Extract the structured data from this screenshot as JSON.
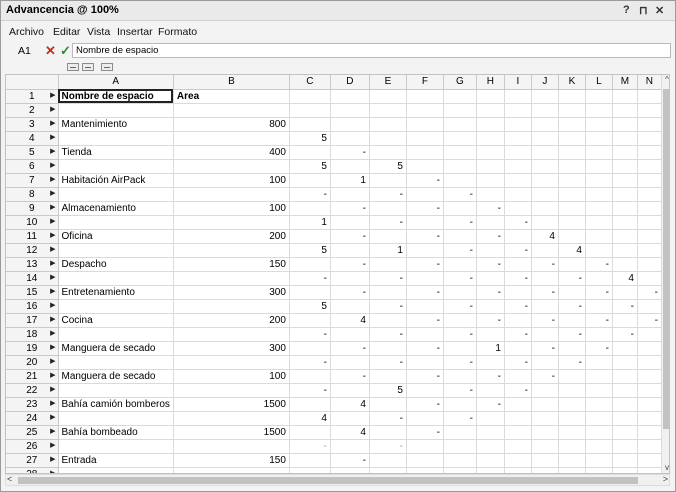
{
  "window": {
    "title": "Advancencia @ 100%",
    "help": "?",
    "pin": "⊓",
    "close": "✕"
  },
  "menu": [
    "Archivo",
    "Editar",
    "Vista",
    "Insertar",
    "Formato"
  ],
  "formula": {
    "cell_ref": "A1",
    "cancel": "✕",
    "accept": "✓",
    "value": "Nombre de espacio"
  },
  "columns": [
    "A",
    "B",
    "C",
    "D",
    "E",
    "F",
    "G",
    "H",
    "I",
    "J",
    "K",
    "L",
    "M",
    "N"
  ],
  "rows": [
    {
      "n": "1",
      "cells": [
        "Nombre de espacio",
        "Area",
        "",
        "",
        "",
        "",
        "",
        "",
        "",
        "",
        "",
        "",
        "",
        ""
      ]
    },
    {
      "n": "2",
      "cells": [
        "",
        "",
        "",
        "",
        "",
        "",
        "",
        "",
        "",
        "",
        "",
        "",
        "",
        ""
      ]
    },
    {
      "n": "3",
      "cells": [
        "Mantenimiento",
        "800",
        "",
        "",
        "",
        "",
        "",
        "",
        "",
        "",
        "",
        "",
        "",
        ""
      ]
    },
    {
      "n": "4",
      "cells": [
        "",
        "",
        "5",
        "",
        "",
        "",
        "",
        "",
        "",
        "",
        "",
        "",
        "",
        ""
      ]
    },
    {
      "n": "5",
      "cells": [
        "Tienda",
        "400",
        "",
        "-",
        "",
        "",
        "",
        "",
        "",
        "",
        "",
        "",
        "",
        ""
      ]
    },
    {
      "n": "6",
      "cells": [
        "",
        "",
        "5",
        "",
        "5",
        "",
        "",
        "",
        "",
        "",
        "",
        "",
        "",
        ""
      ]
    },
    {
      "n": "7",
      "cells": [
        "Habitación AirPack",
        "100",
        "",
        "1",
        "",
        "-",
        "",
        "",
        "",
        "",
        "",
        "",
        "",
        ""
      ]
    },
    {
      "n": "8",
      "cells": [
        "",
        "",
        "-",
        "",
        "-",
        "",
        "-",
        "",
        "",
        "",
        "",
        "",
        "",
        ""
      ]
    },
    {
      "n": "9",
      "cells": [
        "Almacenamiento",
        "100",
        "",
        "-",
        "",
        "-",
        "",
        "-",
        "",
        "",
        "",
        "",
        "",
        ""
      ]
    },
    {
      "n": "10",
      "cells": [
        "",
        "",
        "1",
        "",
        "-",
        "",
        "-",
        "",
        "-",
        "",
        "",
        "",
        "",
        ""
      ]
    },
    {
      "n": "11",
      "cells": [
        "Oficina",
        "200",
        "",
        "-",
        "",
        "-",
        "",
        "-",
        "",
        "4",
        "",
        "",
        "",
        ""
      ]
    },
    {
      "n": "12",
      "cells": [
        "",
        "",
        "5",
        "",
        "1",
        "",
        "-",
        "",
        "-",
        "",
        "4",
        "",
        "",
        ""
      ]
    },
    {
      "n": "13",
      "cells": [
        "Despacho",
        "150",
        "",
        "-",
        "",
        "-",
        "",
        "-",
        "",
        "-",
        "",
        "-",
        "",
        ""
      ]
    },
    {
      "n": "14",
      "cells": [
        "",
        "",
        "-",
        "",
        "-",
        "",
        "-",
        "",
        "-",
        "",
        "-",
        "",
        "4",
        ""
      ]
    },
    {
      "n": "15",
      "cells": [
        "Entretenamiento",
        "300",
        "",
        "-",
        "",
        "-",
        "",
        "-",
        "",
        "-",
        "",
        "-",
        "",
        "-"
      ]
    },
    {
      "n": "16",
      "cells": [
        "",
        "",
        "5",
        "",
        "-",
        "",
        "-",
        "",
        "-",
        "",
        "-",
        "",
        "-",
        ""
      ]
    },
    {
      "n": "17",
      "cells": [
        "Cocina",
        "200",
        "",
        "4",
        "",
        "-",
        "",
        "-",
        "",
        "-",
        "",
        "-",
        "",
        "-"
      ]
    },
    {
      "n": "18",
      "cells": [
        "",
        "",
        "-",
        "",
        "-",
        "",
        "-",
        "",
        "-",
        "",
        "-",
        "",
        "-",
        ""
      ]
    },
    {
      "n": "19",
      "cells": [
        "Manguera de secado",
        "300",
        "",
        "-",
        "",
        "-",
        "",
        "1",
        "",
        "-",
        "",
        "-",
        "",
        ""
      ]
    },
    {
      "n": "20",
      "cells": [
        "",
        "",
        "-",
        "",
        "-",
        "",
        "-",
        "",
        "-",
        "",
        "-",
        "",
        "",
        ""
      ]
    },
    {
      "n": "21",
      "cells": [
        "Manguera de secado",
        "100",
        "",
        "-",
        "",
        "-",
        "",
        "-",
        "",
        "-",
        "",
        "",
        "",
        ""
      ]
    },
    {
      "n": "22",
      "cells": [
        "",
        "",
        "-",
        "",
        "5",
        "",
        "-",
        "",
        "-",
        "",
        "",
        "",
        "",
        ""
      ]
    },
    {
      "n": "23",
      "cells": [
        "Bahía camión bomberos",
        "1500",
        "",
        "4",
        "",
        "-",
        "",
        "-",
        "",
        "",
        "",
        "",
        "",
        ""
      ]
    },
    {
      "n": "24",
      "cells": [
        "",
        "",
        "4",
        "",
        "-",
        "",
        "-",
        "",
        "",
        "",
        "",
        "",
        "",
        ""
      ]
    },
    {
      "n": "25",
      "cells": [
        "Bahía bombeado",
        "1500",
        "",
        "4",
        "",
        "-",
        "",
        "",
        "",
        "",
        "",
        "",
        "",
        ""
      ]
    },
    {
      "n": "26",
      "cells": [
        "",
        "",
        "-",
        "",
        "-",
        "",
        "",
        "",
        "",
        "",
        "",
        "",
        "",
        ""
      ]
    },
    {
      "n": "27",
      "cells": [
        "Entrada",
        "150",
        "",
        "-",
        "",
        "",
        "",
        "",
        "",
        "",
        "",
        "",
        "",
        ""
      ]
    },
    {
      "n": "28",
      "cells": [
        "",
        "",
        "",
        "",
        "",
        "",
        "",
        "",
        "",
        "",
        "",
        "",
        "",
        ""
      ]
    }
  ]
}
